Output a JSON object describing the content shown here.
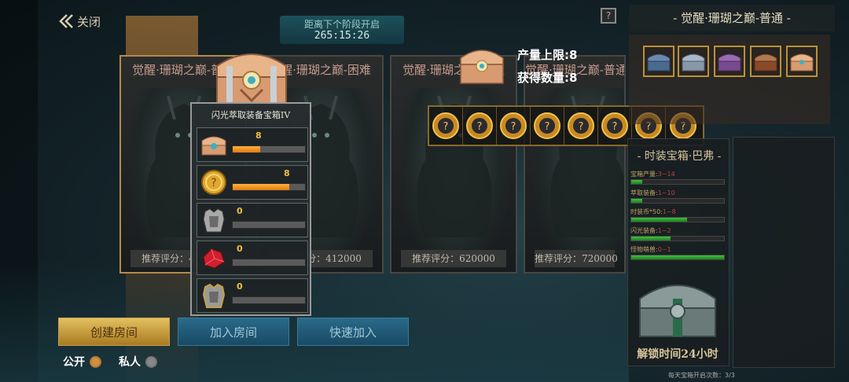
{
  "header": {
    "close_label": "关闭",
    "timer_label": "距离下个阶段开启",
    "timer_value": "265:15:26"
  },
  "cards": [
    {
      "title": "觉醒·珊瑚之巅-普通",
      "score": "推荐评分：412000"
    },
    {
      "title": "觉醒·珊瑚之巅-困难",
      "score": "推荐评分：412000"
    },
    {
      "title": "觉醒·珊瑚之巅-普通",
      "score": "推荐评分：620000"
    },
    {
      "title": "觉醒·珊瑚之巅-普通",
      "score": "推荐评分：720000"
    }
  ],
  "tooltip": {
    "title": "闪光萃取装备宝箱IV",
    "rows": [
      {
        "icon": "chest-icon",
        "count": "8",
        "progress": 0.38
      },
      {
        "icon": "coin-icon",
        "count": "8",
        "progress": 0.78
      },
      {
        "icon": "armor-icon",
        "count": "0",
        "progress": 0
      },
      {
        "icon": "ruby-icon",
        "count": "0",
        "progress": 0
      },
      {
        "icon": "gold-armor-icon",
        "count": "0",
        "progress": 0
      }
    ]
  },
  "reward": {
    "cap_label": "产量上限:8",
    "obtained_label": "获得数量:8",
    "slots": [
      "unknown-reward-icon",
      "unknown-reward-icon",
      "unknown-reward-icon",
      "unknown-reward-icon",
      "unknown-reward-icon",
      "unknown-reward-icon",
      "unknown-reward-icon",
      "unknown-reward-icon"
    ]
  },
  "buttons": {
    "create": "创建房间",
    "join": "加入房间",
    "quick": "快速加入"
  },
  "visibility": {
    "public": "公开",
    "private": "私人"
  },
  "right_panel": {
    "title": "觉醒·珊瑚之巅-普通",
    "list_title": "时装宝箱·巴弗",
    "stats": [
      {
        "label": "宝箱产量:",
        "value": "3~14",
        "fill": 0.12
      },
      {
        "label": "萃取装备:",
        "value": "1~10",
        "fill": 0.12
      },
      {
        "label": "时装币*50:",
        "value": "1~8",
        "fill": 0.6
      },
      {
        "label": "闪光装备:",
        "value": "1~2",
        "fill": 0.42
      },
      {
        "label": "怪物萌兽:",
        "value": "0~1",
        "fill": 1.0
      }
    ],
    "unlock_label": "解锁时间24小时",
    "daily_label": "每天宝箱开启次数：3/3"
  },
  "colors": {
    "accent_gold": "#e4c060",
    "bar_orange": "#f39a2a",
    "bar_green": "#40c040"
  }
}
